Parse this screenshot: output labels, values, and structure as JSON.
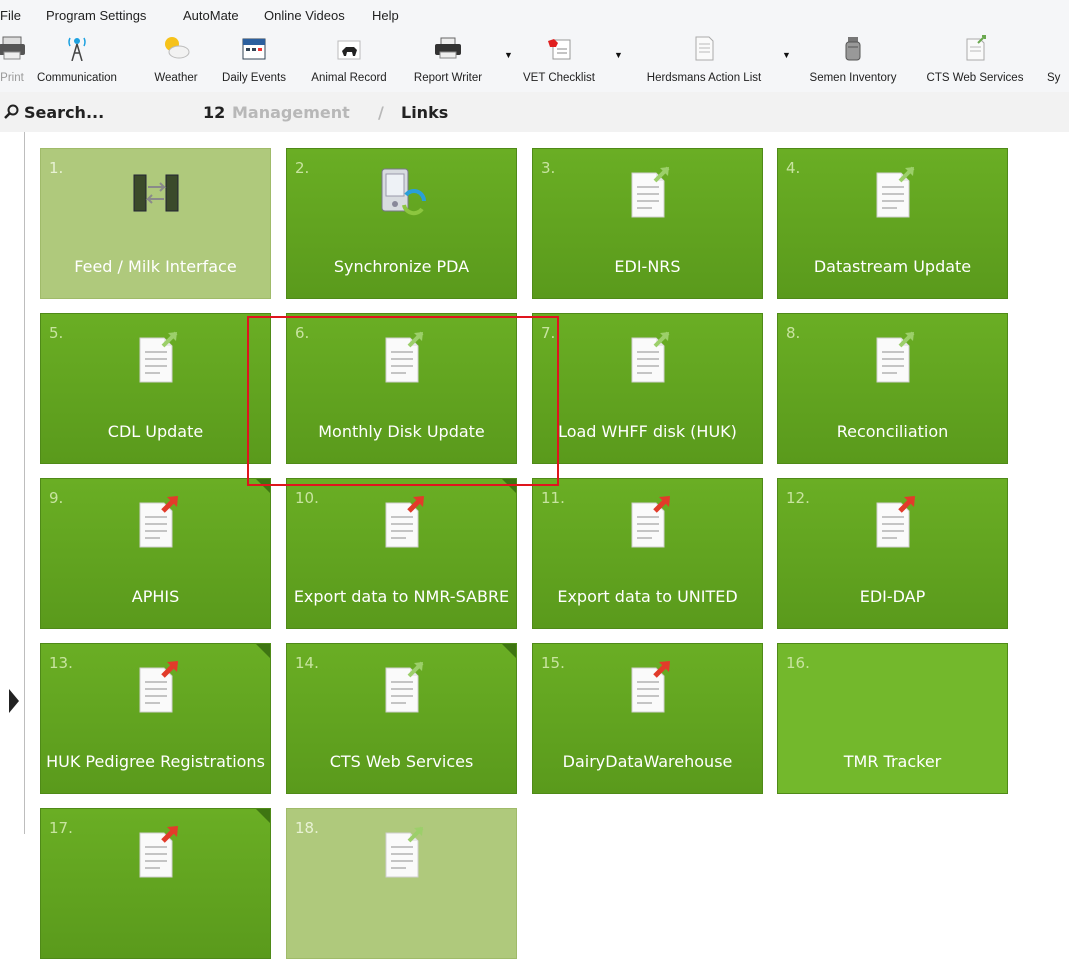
{
  "menu": [
    "File",
    "Program Settings",
    "AutoMate",
    "Online Videos",
    "Help"
  ],
  "toolbar": {
    "items": [
      {
        "label": "Print",
        "icon": "printer-icon"
      },
      {
        "label": "Communication",
        "icon": "antenna-icon"
      },
      {
        "label": "Weather",
        "icon": "weather-icon"
      },
      {
        "label": "Daily Events",
        "icon": "calendar-icon"
      },
      {
        "label": "Animal Record",
        "icon": "cow-icon"
      },
      {
        "label": "Report Writer",
        "icon": "printer-icon"
      },
      {
        "label": "VET Checklist",
        "icon": "checklist-icon"
      },
      {
        "label": "Herdsmans Action List",
        "icon": "document-icon"
      },
      {
        "label": "Semen Inventory",
        "icon": "canister-icon"
      },
      {
        "label": "CTS Web Services",
        "icon": "document-icon"
      },
      {
        "label": "Sy",
        "icon": ""
      }
    ]
  },
  "breadcrumb": {
    "search": "Search...",
    "number": "12",
    "section": "Management",
    "separator": "/",
    "page": "Links"
  },
  "tiles": [
    {
      "num": "1.",
      "label": "Feed / Milk Interface",
      "icon": "feed-milk-interface-icon",
      "style": "light"
    },
    {
      "num": "2.",
      "label": "Synchronize PDA",
      "icon": "pda-sync-icon"
    },
    {
      "num": "3.",
      "label": "EDI-NRS",
      "icon": "document-icon"
    },
    {
      "num": "4.",
      "label": "Datastream Update",
      "icon": "document-icon"
    },
    {
      "num": "5.",
      "label": "CDL Update",
      "icon": "document-icon"
    },
    {
      "num": "6.",
      "label": "Monthly Disk Update",
      "icon": "document-icon"
    },
    {
      "num": "7.",
      "label": "Load WHFF disk (HUK)",
      "icon": "document-icon"
    },
    {
      "num": "8.",
      "label": "Reconciliation",
      "icon": "document-icon"
    },
    {
      "num": "9.",
      "label": "APHIS",
      "icon": "export-document-icon"
    },
    {
      "num": "10.",
      "label": "Export data to NMR-SABRE",
      "icon": "export-document-icon"
    },
    {
      "num": "11.",
      "label": "Export data to UNITED",
      "icon": "export-document-icon"
    },
    {
      "num": "12.",
      "label": "EDI-DAP",
      "icon": "export-document-icon"
    },
    {
      "num": "13.",
      "label": "HUK Pedigree Registrations",
      "icon": "export-document-icon"
    },
    {
      "num": "14.",
      "label": "CTS Web Services",
      "icon": "document-icon"
    },
    {
      "num": "15.",
      "label": "DairyDataWarehouse",
      "icon": "export-document-icon"
    },
    {
      "num": "16.",
      "label": "TMR Tracker",
      "icon": "",
      "style": "bright"
    },
    {
      "num": "17.",
      "label": "",
      "icon": "export-document-icon"
    },
    {
      "num": "18.",
      "label": "",
      "icon": "document-icon",
      "style": "light"
    }
  ],
  "colors": {
    "tile": "#5f9f1f",
    "tile_light": "#afc97c",
    "highlight": "#e0141e",
    "arrow_out": "#e23b2a",
    "arrow_in": "#8bc34a"
  }
}
